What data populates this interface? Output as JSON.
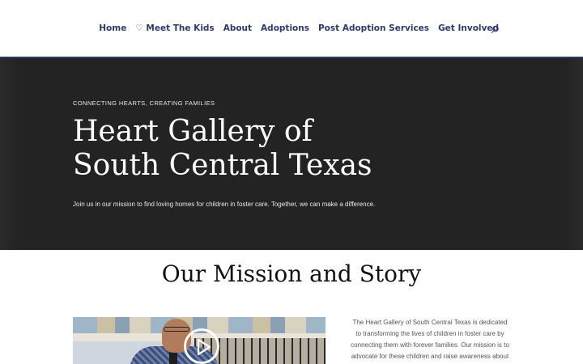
{
  "nav": {
    "items": [
      {
        "label": "Home"
      },
      {
        "label": "♡ Meet The Kids"
      },
      {
        "label": "About"
      },
      {
        "label": "Adoptions"
      },
      {
        "label": "Post Adoption Services"
      },
      {
        "label": "Get Involved"
      }
    ],
    "search_icon": "search-icon"
  },
  "hero": {
    "kicker": "CONNECTING HEARTS, CREATING FAMILIES",
    "title_line1": "Heart Gallery of",
    "title_line2": "South Central Texas",
    "subtitle": "Join us in our mission to find loving homes for children in foster care. Together, we can make a difference."
  },
  "mission": {
    "title": "Our Mission and Story",
    "video_icon": "play-icon",
    "text": "The Heart Gallery of South Central Texas is dedicated to transforming the lives of children in foster care by connecting them with forever families. Our mission is to advocate for these children and raise awareness about the"
  },
  "colors": {
    "nav_text": "#2e3a6b",
    "hero_bg": "#232323",
    "header_border": "#2f3a63"
  }
}
